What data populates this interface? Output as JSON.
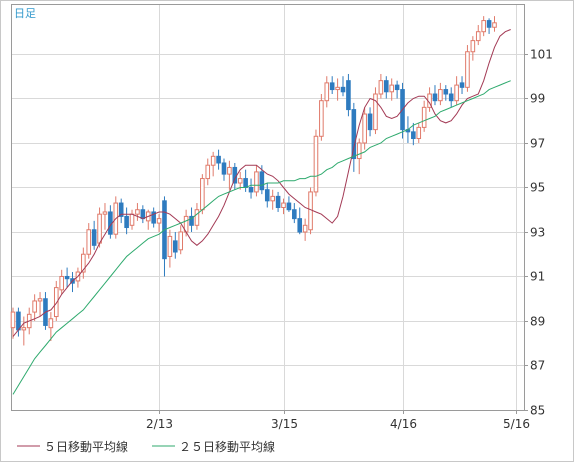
{
  "chart_data": {
    "type": "candlestick",
    "period_label": "日足",
    "ylim": [
      85,
      103.2
    ],
    "y_ticks": [
      85,
      87,
      89,
      91,
      93,
      95,
      97,
      99,
      101
    ],
    "x_ticks": [
      {
        "index": 27,
        "label": "2/13"
      },
      {
        "index": 50,
        "label": "3/15"
      },
      {
        "index": 72,
        "label": "4/16"
      },
      {
        "index": 93,
        "label": "5/16"
      }
    ],
    "grid": true,
    "legend_position": "bottom-left",
    "colors": {
      "up": "#e07a6a",
      "down": "#2e7bbf",
      "ma5": "#a33a55",
      "ma25": "#2faa6e",
      "grid": "#d9d9d9",
      "frame": "#9a9a9a",
      "period_label": "#3399cc"
    },
    "series": [
      {
        "name": "５日移動平均線",
        "line_color": "#a33a55",
        "values": [
          88.3,
          88.6,
          88.9,
          89.0,
          89.1,
          89.2,
          89.4,
          89.5,
          89.8,
          90.2,
          90.5,
          90.8,
          91.0,
          91.3,
          91.6,
          92.0,
          92.5,
          92.9,
          93.3,
          93.6,
          93.8,
          93.8,
          93.8,
          93.7,
          93.6,
          93.7,
          93.8,
          93.9,
          93.9,
          93.8,
          93.6,
          93.4,
          93.0,
          92.6,
          92.4,
          92.6,
          92.9,
          93.3,
          93.7,
          94.2,
          94.8,
          95.4,
          95.8,
          96.0,
          96.0,
          96.0,
          95.8,
          95.6,
          95.5,
          95.3,
          95.0,
          94.7,
          94.5,
          94.3,
          94.1,
          94.0,
          93.9,
          93.8,
          93.6,
          93.4,
          93.7,
          94.6,
          95.7,
          96.8,
          97.8,
          98.6,
          99.0,
          98.9,
          98.6,
          98.2,
          98.1,
          98.2,
          98.5,
          98.8,
          99.0,
          99.1,
          99.1,
          98.8,
          98.3,
          98.0,
          97.9,
          98.0,
          98.3,
          98.7,
          99.0,
          99.1,
          99.2,
          99.8,
          100.6,
          101.3,
          101.8,
          102.0,
          102.1
        ]
      },
      {
        "name": "２５日移動平均線",
        "line_color": "#2faa6e",
        "values": [
          85.7,
          86.1,
          86.5,
          86.9,
          87.3,
          87.6,
          87.9,
          88.2,
          88.5,
          88.7,
          88.9,
          89.1,
          89.3,
          89.5,
          89.8,
          90.1,
          90.4,
          90.7,
          91.0,
          91.3,
          91.6,
          91.9,
          92.1,
          92.3,
          92.5,
          92.7,
          92.8,
          92.9,
          93.1,
          93.2,
          93.3,
          93.4,
          93.5,
          93.6,
          93.8,
          94.0,
          94.2,
          94.4,
          94.6,
          94.7,
          94.8,
          94.9,
          95.0,
          95.0,
          95.1,
          95.1,
          95.1,
          95.2,
          95.2,
          95.2,
          95.3,
          95.3,
          95.3,
          95.4,
          95.4,
          95.5,
          95.5,
          95.6,
          95.8,
          95.9,
          96.1,
          96.2,
          96.3,
          96.4,
          96.5,
          96.6,
          96.8,
          96.9,
          97.0,
          97.2,
          97.3,
          97.4,
          97.5,
          97.6,
          97.8,
          97.9,
          98.0,
          98.1,
          98.2,
          98.4,
          98.5,
          98.6,
          98.7,
          98.8,
          98.9,
          99.0,
          99.1,
          99.2,
          99.4,
          99.5,
          99.6,
          99.7,
          99.8
        ]
      }
    ],
    "candles": [
      {
        "o": 88.7,
        "h": 89.6,
        "l": 88.2,
        "c": 89.4
      },
      {
        "o": 89.4,
        "h": 89.6,
        "l": 88.3,
        "c": 88.6
      },
      {
        "o": 88.6,
        "h": 89.2,
        "l": 87.9,
        "c": 88.7
      },
      {
        "o": 88.7,
        "h": 89.6,
        "l": 88.4,
        "c": 89.3
      },
      {
        "o": 89.4,
        "h": 90.2,
        "l": 89.0,
        "c": 89.9
      },
      {
        "o": 89.9,
        "h": 90.3,
        "l": 89.2,
        "c": 90.0
      },
      {
        "o": 90.0,
        "h": 90.3,
        "l": 88.6,
        "c": 88.8
      },
      {
        "o": 88.7,
        "h": 89.4,
        "l": 88.1,
        "c": 89.1
      },
      {
        "o": 89.2,
        "h": 90.8,
        "l": 89.0,
        "c": 90.5
      },
      {
        "o": 90.4,
        "h": 91.3,
        "l": 90.2,
        "c": 91.0
      },
      {
        "o": 91.0,
        "h": 91.4,
        "l": 90.5,
        "c": 90.9
      },
      {
        "o": 90.9,
        "h": 91.2,
        "l": 90.3,
        "c": 90.7
      },
      {
        "o": 90.8,
        "h": 91.4,
        "l": 90.5,
        "c": 91.2
      },
      {
        "o": 91.2,
        "h": 92.3,
        "l": 90.9,
        "c": 92.0
      },
      {
        "o": 92.0,
        "h": 93.4,
        "l": 91.8,
        "c": 93.1
      },
      {
        "o": 93.1,
        "h": 93.5,
        "l": 92.2,
        "c": 92.4
      },
      {
        "o": 92.5,
        "h": 94.1,
        "l": 92.3,
        "c": 93.8
      },
      {
        "o": 93.8,
        "h": 94.3,
        "l": 93.1,
        "c": 93.9
      },
      {
        "o": 93.9,
        "h": 94.2,
        "l": 92.7,
        "c": 92.9
      },
      {
        "o": 92.9,
        "h": 94.6,
        "l": 92.7,
        "c": 94.3
      },
      {
        "o": 94.3,
        "h": 94.5,
        "l": 93.4,
        "c": 93.7
      },
      {
        "o": 93.7,
        "h": 94.1,
        "l": 92.9,
        "c": 93.2
      },
      {
        "o": 93.3,
        "h": 94.0,
        "l": 93.1,
        "c": 93.8
      },
      {
        "o": 93.8,
        "h": 94.3,
        "l": 93.5,
        "c": 94.0
      },
      {
        "o": 94.0,
        "h": 94.2,
        "l": 93.4,
        "c": 93.6
      },
      {
        "o": 93.5,
        "h": 94.0,
        "l": 93.1,
        "c": 93.9
      },
      {
        "o": 93.9,
        "h": 94.1,
        "l": 93.2,
        "c": 93.4
      },
      {
        "o": 93.4,
        "h": 93.8,
        "l": 93.0,
        "c": 93.6
      },
      {
        "o": 94.4,
        "h": 94.6,
        "l": 91.0,
        "c": 91.8
      },
      {
        "o": 91.9,
        "h": 93.1,
        "l": 91.4,
        "c": 92.8
      },
      {
        "o": 92.6,
        "h": 93.0,
        "l": 91.8,
        "c": 92.1
      },
      {
        "o": 92.2,
        "h": 93.3,
        "l": 92.0,
        "c": 93.0
      },
      {
        "o": 93.0,
        "h": 94.0,
        "l": 92.8,
        "c": 93.7
      },
      {
        "o": 93.7,
        "h": 94.1,
        "l": 93.0,
        "c": 93.3
      },
      {
        "o": 93.3,
        "h": 94.3,
        "l": 93.1,
        "c": 94.0
      },
      {
        "o": 94.0,
        "h": 95.6,
        "l": 93.8,
        "c": 95.4
      },
      {
        "o": 95.4,
        "h": 96.3,
        "l": 95.1,
        "c": 96.0
      },
      {
        "o": 96.0,
        "h": 96.6,
        "l": 95.5,
        "c": 96.4
      },
      {
        "o": 96.4,
        "h": 96.7,
        "l": 95.8,
        "c": 96.1
      },
      {
        "o": 96.1,
        "h": 96.3,
        "l": 95.3,
        "c": 95.6
      },
      {
        "o": 95.6,
        "h": 96.2,
        "l": 94.9,
        "c": 95.9
      },
      {
        "o": 95.9,
        "h": 96.1,
        "l": 94.9,
        "c": 95.2
      },
      {
        "o": 95.2,
        "h": 95.7,
        "l": 94.9,
        "c": 95.4
      },
      {
        "o": 95.4,
        "h": 95.8,
        "l": 94.8,
        "c": 95.0
      },
      {
        "o": 95.0,
        "h": 95.4,
        "l": 94.5,
        "c": 94.8
      },
      {
        "o": 94.8,
        "h": 96.0,
        "l": 94.6,
        "c": 95.7
      },
      {
        "o": 95.7,
        "h": 96.0,
        "l": 94.7,
        "c": 94.9
      },
      {
        "o": 94.9,
        "h": 95.2,
        "l": 94.1,
        "c": 94.4
      },
      {
        "o": 94.4,
        "h": 94.9,
        "l": 94.0,
        "c": 94.6
      },
      {
        "o": 94.6,
        "h": 94.8,
        "l": 93.9,
        "c": 94.1
      },
      {
        "o": 94.1,
        "h": 94.5,
        "l": 93.8,
        "c": 94.3
      },
      {
        "o": 94.3,
        "h": 94.6,
        "l": 93.9,
        "c": 94.0
      },
      {
        "o": 94.0,
        "h": 94.3,
        "l": 93.4,
        "c": 93.6
      },
      {
        "o": 93.6,
        "h": 94.1,
        "l": 92.9,
        "c": 93.0
      },
      {
        "o": 93.0,
        "h": 93.6,
        "l": 92.6,
        "c": 93.3
      },
      {
        "o": 93.1,
        "h": 95.0,
        "l": 92.9,
        "c": 94.8
      },
      {
        "o": 94.8,
        "h": 97.6,
        "l": 94.6,
        "c": 97.3
      },
      {
        "o": 97.3,
        "h": 99.2,
        "l": 97.1,
        "c": 98.9
      },
      {
        "o": 98.9,
        "h": 100.0,
        "l": 98.6,
        "c": 99.7
      },
      {
        "o": 99.7,
        "h": 100.0,
        "l": 99.2,
        "c": 99.4
      },
      {
        "o": 99.4,
        "h": 99.9,
        "l": 98.9,
        "c": 99.5
      },
      {
        "o": 99.5,
        "h": 100.0,
        "l": 99.1,
        "c": 99.3
      },
      {
        "o": 99.8,
        "h": 100.1,
        "l": 98.2,
        "c": 98.5
      },
      {
        "o": 98.5,
        "h": 98.8,
        "l": 95.7,
        "c": 96.3
      },
      {
        "o": 96.3,
        "h": 97.2,
        "l": 95.6,
        "c": 97.0
      },
      {
        "o": 97.0,
        "h": 98.6,
        "l": 96.7,
        "c": 98.3
      },
      {
        "o": 98.3,
        "h": 98.6,
        "l": 97.3,
        "c": 97.6
      },
      {
        "o": 97.6,
        "h": 99.5,
        "l": 97.4,
        "c": 99.2
      },
      {
        "o": 99.2,
        "h": 100.1,
        "l": 99.0,
        "c": 99.8
      },
      {
        "o": 99.8,
        "h": 100.0,
        "l": 99.0,
        "c": 99.3
      },
      {
        "o": 99.3,
        "h": 99.9,
        "l": 98.9,
        "c": 99.6
      },
      {
        "o": 99.6,
        "h": 99.8,
        "l": 99.0,
        "c": 99.4
      },
      {
        "o": 99.4,
        "h": 99.7,
        "l": 97.2,
        "c": 97.6
      },
      {
        "o": 97.6,
        "h": 98.2,
        "l": 97.0,
        "c": 97.5
      },
      {
        "o": 97.5,
        "h": 97.9,
        "l": 96.9,
        "c": 97.2
      },
      {
        "o": 97.2,
        "h": 97.9,
        "l": 97.0,
        "c": 97.7
      },
      {
        "o": 97.7,
        "h": 98.9,
        "l": 97.5,
        "c": 98.6
      },
      {
        "o": 98.6,
        "h": 99.5,
        "l": 98.4,
        "c": 99.2
      },
      {
        "o": 99.2,
        "h": 99.6,
        "l": 98.7,
        "c": 98.9
      },
      {
        "o": 98.9,
        "h": 99.7,
        "l": 98.7,
        "c": 99.4
      },
      {
        "o": 99.4,
        "h": 99.6,
        "l": 98.9,
        "c": 99.2
      },
      {
        "o": 99.2,
        "h": 99.5,
        "l": 98.6,
        "c": 98.9
      },
      {
        "o": 98.9,
        "h": 100.0,
        "l": 98.7,
        "c": 99.6
      },
      {
        "o": 99.7,
        "h": 100.0,
        "l": 99.2,
        "c": 99.5
      },
      {
        "o": 99.5,
        "h": 101.4,
        "l": 99.3,
        "c": 101.1
      },
      {
        "o": 101.1,
        "h": 101.8,
        "l": 100.7,
        "c": 101.6
      },
      {
        "o": 101.6,
        "h": 102.3,
        "l": 101.4,
        "c": 102.0
      },
      {
        "o": 102.0,
        "h": 102.7,
        "l": 101.8,
        "c": 102.5
      },
      {
        "o": 102.5,
        "h": 102.6,
        "l": 101.9,
        "c": 102.2
      },
      {
        "o": 102.2,
        "h": 102.7,
        "l": 102.0,
        "c": 102.4
      }
    ]
  },
  "legend": [
    {
      "label": "５日移動平均線",
      "color": "#a33a55"
    },
    {
      "label": "２５日移動平均線",
      "color": "#2faa6e"
    }
  ]
}
